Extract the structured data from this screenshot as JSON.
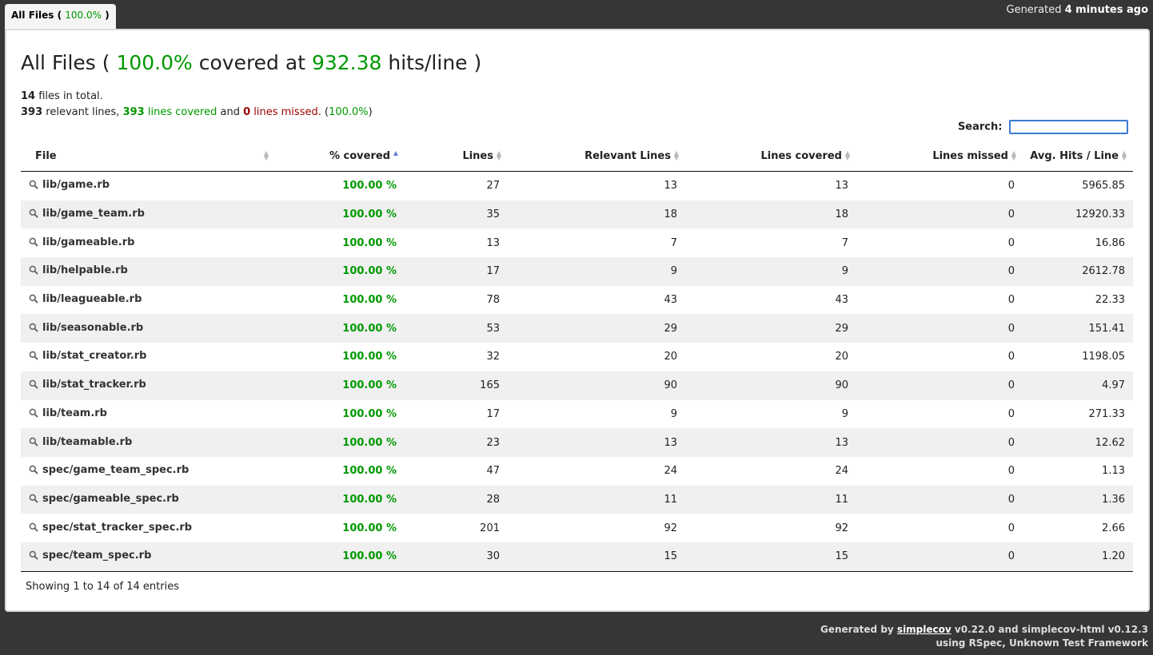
{
  "tab": {
    "label": "All Files",
    "pct": "100.0%"
  },
  "header": {
    "generated_prefix": "Generated",
    "generated_time": "4 minutes ago"
  },
  "title": {
    "prefix": "All Files (",
    "pct": "100.0%",
    "mid": "covered at",
    "hits": "932.38",
    "suffix": "hits/line )"
  },
  "summary": {
    "files_count": "14",
    "files_text": "files in total.",
    "relevant": "393",
    "relevant_text": "relevant lines,",
    "covered": "393",
    "covered_text": "lines covered",
    "and_text": "and",
    "missed": "0",
    "missed_text": "lines missed.",
    "pct_open": "(",
    "pct": "100.0%",
    "pct_close": ")"
  },
  "search": {
    "label": "Search:",
    "value": ""
  },
  "table": {
    "headers": [
      "File",
      "% covered",
      "Lines",
      "Relevant Lines",
      "Lines covered",
      "Lines missed",
      "Avg. Hits / Line"
    ],
    "rows": [
      {
        "file": "lib/game.rb",
        "pct": "100.00 %",
        "lines": "27",
        "relevant": "13",
        "covered": "13",
        "missed": "0",
        "avg": "5965.85"
      },
      {
        "file": "lib/game_team.rb",
        "pct": "100.00 %",
        "lines": "35",
        "relevant": "18",
        "covered": "18",
        "missed": "0",
        "avg": "12920.33"
      },
      {
        "file": "lib/gameable.rb",
        "pct": "100.00 %",
        "lines": "13",
        "relevant": "7",
        "covered": "7",
        "missed": "0",
        "avg": "16.86"
      },
      {
        "file": "lib/helpable.rb",
        "pct": "100.00 %",
        "lines": "17",
        "relevant": "9",
        "covered": "9",
        "missed": "0",
        "avg": "2612.78"
      },
      {
        "file": "lib/leagueable.rb",
        "pct": "100.00 %",
        "lines": "78",
        "relevant": "43",
        "covered": "43",
        "missed": "0",
        "avg": "22.33"
      },
      {
        "file": "lib/seasonable.rb",
        "pct": "100.00 %",
        "lines": "53",
        "relevant": "29",
        "covered": "29",
        "missed": "0",
        "avg": "151.41"
      },
      {
        "file": "lib/stat_creator.rb",
        "pct": "100.00 %",
        "lines": "32",
        "relevant": "20",
        "covered": "20",
        "missed": "0",
        "avg": "1198.05"
      },
      {
        "file": "lib/stat_tracker.rb",
        "pct": "100.00 %",
        "lines": "165",
        "relevant": "90",
        "covered": "90",
        "missed": "0",
        "avg": "4.97"
      },
      {
        "file": "lib/team.rb",
        "pct": "100.00 %",
        "lines": "17",
        "relevant": "9",
        "covered": "9",
        "missed": "0",
        "avg": "271.33"
      },
      {
        "file": "lib/teamable.rb",
        "pct": "100.00 %",
        "lines": "23",
        "relevant": "13",
        "covered": "13",
        "missed": "0",
        "avg": "12.62"
      },
      {
        "file": "spec/game_team_spec.rb",
        "pct": "100.00 %",
        "lines": "47",
        "relevant": "24",
        "covered": "24",
        "missed": "0",
        "avg": "1.13"
      },
      {
        "file": "spec/gameable_spec.rb",
        "pct": "100.00 %",
        "lines": "28",
        "relevant": "11",
        "covered": "11",
        "missed": "0",
        "avg": "1.36"
      },
      {
        "file": "spec/stat_tracker_spec.rb",
        "pct": "100.00 %",
        "lines": "201",
        "relevant": "92",
        "covered": "92",
        "missed": "0",
        "avg": "2.66"
      },
      {
        "file": "spec/team_spec.rb",
        "pct": "100.00 %",
        "lines": "30",
        "relevant": "15",
        "covered": "15",
        "missed": "0",
        "avg": "1.20"
      }
    ]
  },
  "status": "Showing 1 to 14 of 14 entries",
  "footer": {
    "generated_by": "Generated by",
    "link": "simplecov",
    "version_text": "v0.22.0 and simplecov-html v0.12.3",
    "using_text": "using RSpec, Unknown Test Framework"
  },
  "colors": {
    "covered": "#009900",
    "missed": "#990000",
    "background": "#363636"
  },
  "icons": {
    "file_row": "magnifier-icon",
    "sort": "sort-arrows-icon"
  }
}
